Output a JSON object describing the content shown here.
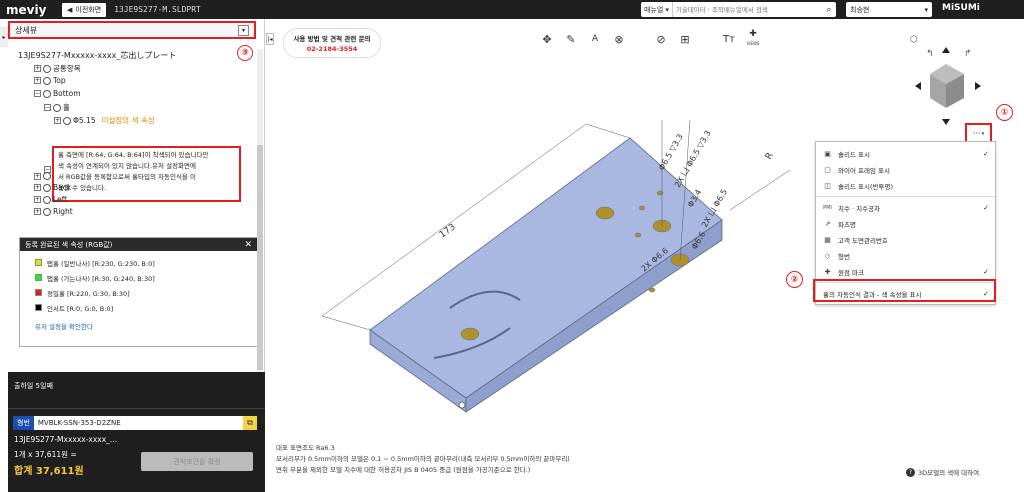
{
  "topbar": {
    "logo": "meviy",
    "back_label": "이전화면",
    "filename": "13JE9S277-M.SLDPRT",
    "search_select": "매뉴얼",
    "search_placeholder": "기술데이터 · 조작매뉴얼에서 검색",
    "user_name": "최승현",
    "brand": "MiSUMi"
  },
  "left_panel": {
    "header_label": "상세뷰",
    "callout": "③",
    "tree_title": "13JE9S277-Mxxxxx-xxxx_芯出しプレート",
    "tree": [
      {
        "label": "공통항목"
      },
      {
        "label": "Top"
      },
      {
        "label": "Bottom"
      },
      {
        "label": "홀"
      },
      {
        "label": "Φ5.15",
        "note": "미설정의 색 속성"
      },
      {
        "label": "Back"
      },
      {
        "label": "Left"
      },
      {
        "label": "Right"
      }
    ],
    "tooltip_lines": [
      "홀 측면에 [R:64, G:64, B:64]이 착색되어 있습니다만",
      "색 속성이 연계되어 있지 않습니다.유저 설정화면에",
      "서 RGB값을 등록함으로써 홀타입의 자동인식을 이",
      "용할 수 있습니다."
    ],
    "legend": {
      "title": "등록 완료된 색 속성 (RGB값)",
      "items": [
        {
          "label": "탭홀 (일반나사) [R:230, G:230, B:0]",
          "color": "#e6e600"
        },
        {
          "label": "탭홀 (가는나사) [R:30, G:240, B:30]",
          "color": "#1ef01e"
        },
        {
          "label": "정밀홀 [R:220, G:30, B:30]",
          "color": "#dc1e1e"
        },
        {
          "label": "인서트 [R:0, G:0, B:0]",
          "color": "#000000"
        }
      ],
      "link": "유저 설정을 확인한다"
    }
  },
  "price": {
    "ship_text": "출하일 5일째",
    "partno_label": "형번",
    "partno_value": "MVBLK-SSN-353-D2ZNE",
    "part_full": "13JE9S277-Mxxxxx-xxxx_...",
    "qty": "1개 x 37,611원 =",
    "total": "합계 37,611원",
    "confirm": "견적조건을 확정"
  },
  "viewer": {
    "contact_line1": "사용 방법 및 견적 관련 문의",
    "contact_line2": "02-2184-3554",
    "toolbar_icons": [
      "pin-icon",
      "dimension-icon",
      "text-dim-icon",
      "delete-icon",
      "hide-icon",
      "grid-icon",
      "text-size-icon",
      "views-icon"
    ],
    "views_label": "VIEWS",
    "callout1": "①",
    "callout2": "②",
    "menu_dots": "···",
    "dimensions": {
      "length": "173",
      "d1": "Φ6.5 ▽3.3",
      "d2": "2X 凵 Φ6.5 ▽3.3",
      "d3": "Φ3.4",
      "d4": "2X 凵 Φ6.5",
      "d5": "Φ6.6",
      "d6": "2X Φ6.6",
      "r": "R"
    },
    "view_menu": [
      {
        "label": "솔리드 표시",
        "checked": true
      },
      {
        "label": "와이어 프레임 표시",
        "checked": false
      },
      {
        "label": "솔리드 표시(반투명)",
        "checked": false
      },
      {
        "label": "치수 · 치수공차",
        "checked": true
      },
      {
        "label": "파츠명",
        "checked": false
      },
      {
        "label": "고객 도면관리번호",
        "checked": false
      },
      {
        "label": "형번",
        "checked": false
      },
      {
        "label": "원점 마크",
        "checked": true
      },
      {
        "label": "홀의 자동인식 결과 - 색 속성을 표시",
        "checked": true
      }
    ],
    "notes": [
      "대표 표면조도 Ra6.3",
      "모서리부가 0.5mm이하의 모델은 0.1 ~ 0.5mm이하의 끝마무리(내측 모서리부 0.5mm이하의 끝마무리)",
      "면취 부분을 제외한 모델 치수에 대한 허용공차 JIS B 0405 중급 (원점을 가공기준으로 한다.)"
    ],
    "help": "3D모델의 색에 대하여"
  },
  "colors": {
    "part_fill": "#a9b8e0",
    "part_edge": "#5a6888",
    "hole_fill": "#b0902a",
    "accent_red": "#e02020"
  }
}
